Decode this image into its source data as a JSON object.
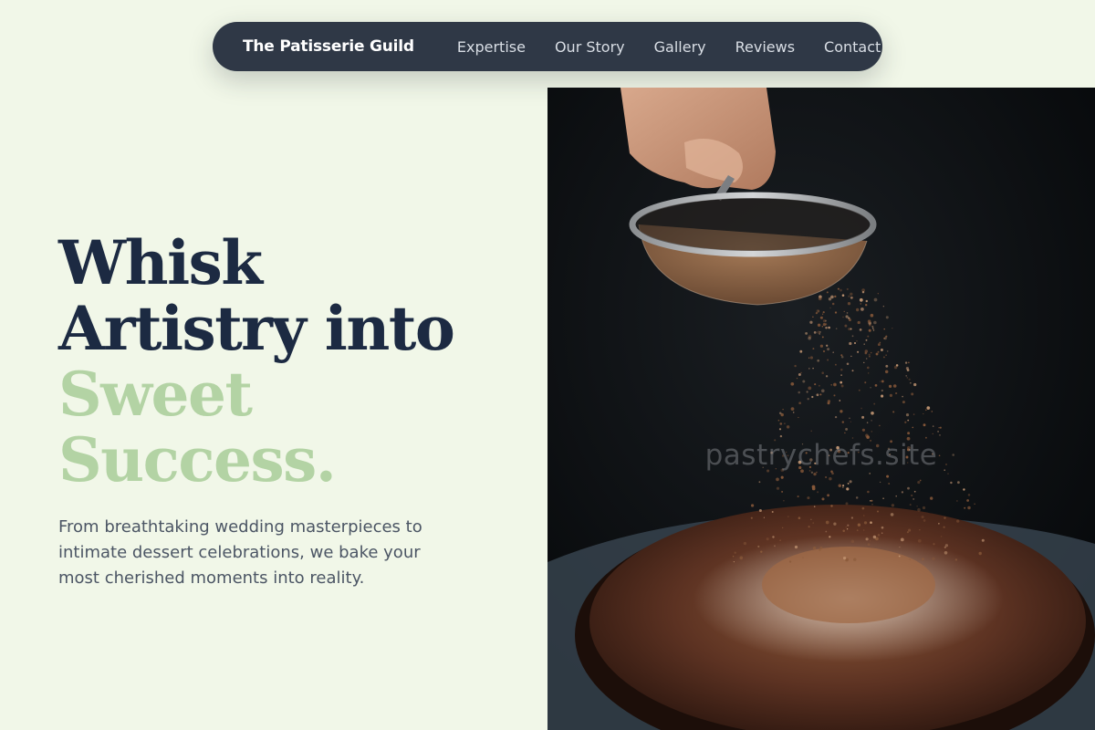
{
  "brand": {
    "name": "The Patisserie Guild"
  },
  "nav": {
    "items": [
      {
        "label": "Expertise"
      },
      {
        "label": "Our Story"
      },
      {
        "label": "Gallery"
      },
      {
        "label": "Reviews"
      },
      {
        "label": "Contact"
      }
    ]
  },
  "hero": {
    "headline_line1": "Whisk",
    "headline_line2": "Artistry into",
    "headline_line3": "Sweet",
    "headline_line4": "Success.",
    "subtitle": "From breathtaking wedding masterpieces to intimate dessert celebrations, we bake your most cherished moments into reality."
  },
  "photo": {
    "watermark": "pastrychefs.site"
  },
  "colors": {
    "background": "#f1f7e8",
    "nav_bg": "#2f3846",
    "headline_dark": "#1c2a42",
    "headline_accent": "#b3d3a4",
    "subtitle": "#4b5564"
  }
}
